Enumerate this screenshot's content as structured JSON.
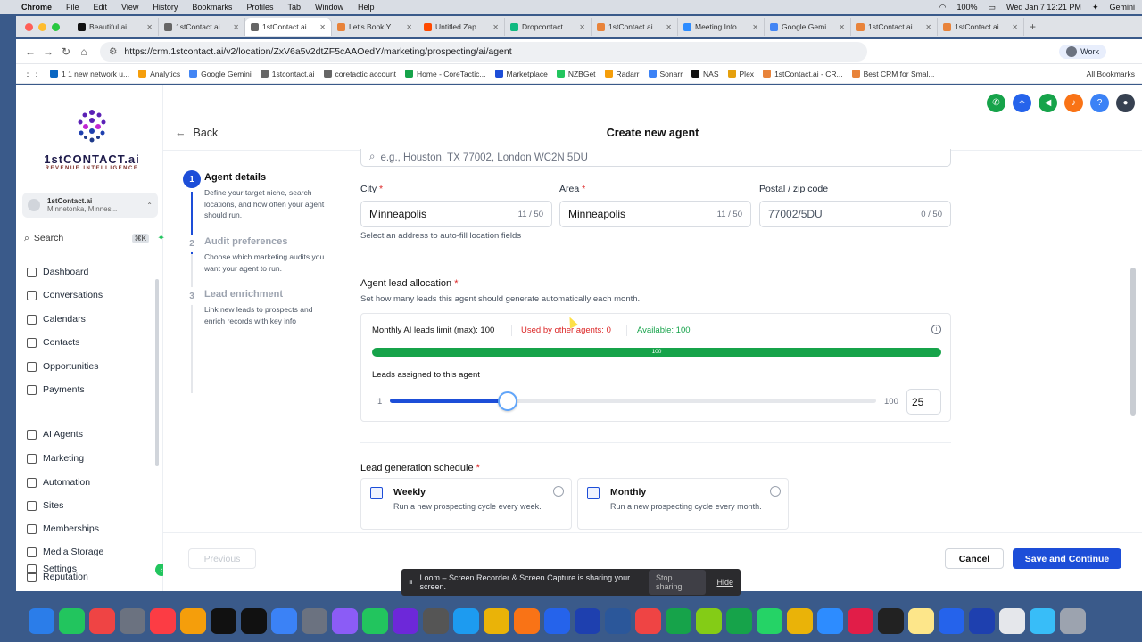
{
  "menubar": {
    "app": "Chrome",
    "items": [
      "File",
      "Edit",
      "View",
      "History",
      "Bookmarks",
      "Profiles",
      "Tab",
      "Window",
      "Help"
    ],
    "battery": "100%",
    "datetime": "Wed Jan 7  12:21 PM",
    "gemini": "Gemini"
  },
  "tabs": [
    {
      "label": "Beautiful.ai",
      "color": "#111"
    },
    {
      "label": "1stContact.ai",
      "color": "#666"
    },
    {
      "label": "1stContact.ai",
      "color": "#666",
      "active": true
    },
    {
      "label": "Let's Book Y",
      "color": "#e8833a"
    },
    {
      "label": "Untitled Zap",
      "color": "#ff4a00"
    },
    {
      "label": "Dropcontact",
      "color": "#10b981"
    },
    {
      "label": "1stContact.ai",
      "color": "#e8833a"
    },
    {
      "label": "Meeting Info",
      "color": "#2d8cff"
    },
    {
      "label": "Google Gemi",
      "color": "#4285f4"
    },
    {
      "label": "1stContact.ai",
      "color": "#e8833a"
    },
    {
      "label": "1stContact.ai",
      "color": "#e8833a"
    }
  ],
  "address": {
    "url": "https://crm.1stcontact.ai/v2/location/ZxV6a5v2dtZF5cAAOedY/marketing/prospecting/ai/agent",
    "profile": "Work"
  },
  "bookmarks": [
    "1 1 new network u...",
    "Analytics",
    "Google Gemini",
    "1stcontact.ai",
    "coretactic account",
    "Home - CoreTactic...",
    "Marketplace",
    "NZBGet",
    "Radarr",
    "Sonarr",
    "NAS",
    "Plex",
    "1stContact.ai - CR...",
    "Best CRM for Smal..."
  ],
  "all_bookmarks": "All Bookmarks",
  "brand": {
    "name": "1stCONTACT.ai",
    "tagline": "REVENUE INTELLIGENCE"
  },
  "location": {
    "name": "1stContact.ai",
    "city": "Minnetonka, Minnes..."
  },
  "search": {
    "label": "Search",
    "shortcut": "⌘K"
  },
  "nav": [
    "Dashboard",
    "Conversations",
    "Calendars",
    "Contacts",
    "Opportunities",
    "Payments",
    "AI Agents",
    "Marketing",
    "Automation",
    "Sites",
    "Memberships",
    "Media Storage",
    "Settings",
    "Reputation"
  ],
  "header": {
    "back": "Back",
    "title": "Create new agent"
  },
  "steps": [
    {
      "num": "1",
      "title": "Agent details",
      "desc": "Define your target niche, search locations, and how often your agent should run."
    },
    {
      "num": "2",
      "title": "Audit preferences",
      "desc": "Choose which marketing audits you want your agent to run."
    },
    {
      "num": "3",
      "title": "Lead enrichment",
      "desc": "Link new leads to prospects and enrich records with key info"
    }
  ],
  "address_search": {
    "placeholder": "e.g., Houston, TX 77002, London WC2N 5DU"
  },
  "fields": {
    "city": {
      "label": "City",
      "value": "Minneapolis",
      "count": "11 / 50"
    },
    "area": {
      "label": "Area",
      "value": "Minneapolis",
      "count": "11 / 50"
    },
    "postal": {
      "label": "Postal / zip code",
      "value": "77002/5DU",
      "count": "0 / 50"
    },
    "hint": "Select an address to auto-fill location fields"
  },
  "allocation": {
    "title": "Agent lead allocation",
    "desc": "Set how many leads this agent should generate automatically each month.",
    "limit": "Monthly AI leads limit (max): 100",
    "used": "Used by other agents: 0",
    "available": "Available: 100",
    "bar_label": "100",
    "bar_fraction": 1.0,
    "assigned_label": "Leads assigned to this agent",
    "min": "1",
    "max": "100",
    "value": "25",
    "colors": {
      "used": "#dc2626",
      "available": "#16a34a"
    }
  },
  "schedule": {
    "title": "Lead generation schedule",
    "options": [
      {
        "title": "Weekly",
        "desc": "Run a new prospecting cycle every week."
      },
      {
        "title": "Monthly",
        "desc": "Run a new prospecting cycle every month."
      }
    ]
  },
  "footer": {
    "previous": "Previous",
    "cancel": "Cancel",
    "save": "Save and Continue"
  },
  "loom": {
    "message": "Loom – Screen Recorder & Screen Capture is sharing your screen.",
    "stop": "Stop sharing",
    "hide": "Hide"
  },
  "colors": {
    "primary": "#1d4ed8",
    "success": "#16a34a",
    "danger": "#dc2626"
  }
}
